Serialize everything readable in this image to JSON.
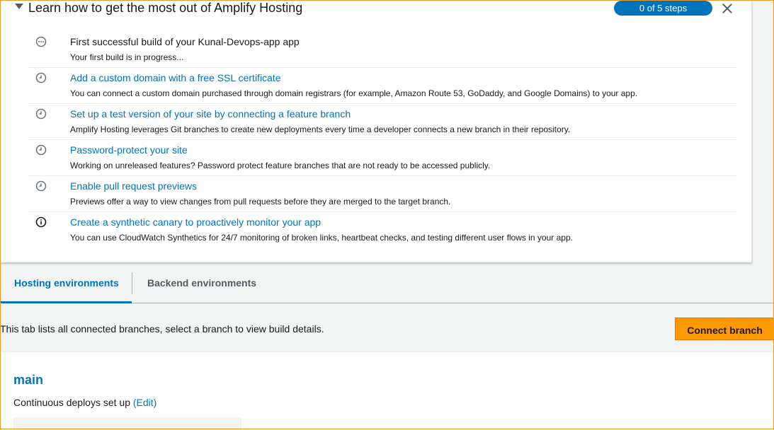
{
  "getting_started": {
    "title": "Learn how to get the most out of Amplify Hosting",
    "progress_badge": "0 of 5 steps complete",
    "steps": [
      {
        "icon": "in-progress-icon",
        "title": "First successful build of your Kunal-Devops-app app",
        "description": "Your first build is in progress..."
      },
      {
        "icon": "pending-clock-icon",
        "title": "Add a custom domain with a free SSL certificate",
        "description": "You can connect a custom domain purchased through domain registrars (for example, Amazon Route 53, GoDaddy, and Google Domains) to your app."
      },
      {
        "icon": "pending-clock-icon",
        "title": "Set up a test version of your site by connecting a feature branch",
        "description": "Amplify Hosting leverages Git branches to create new deployments every time a developer connects a new branch in their repository."
      },
      {
        "icon": "pending-clock-icon",
        "title": "Password-protect your site",
        "description": "Working on unreleased features? Password protect feature branches that are not ready to be accessed publicly."
      },
      {
        "icon": "pending-clock-icon",
        "title": "Enable pull request previews",
        "description": "Previews offer a way to view changes from pull requests before they are merged to the target branch."
      },
      {
        "icon": "info-icon",
        "title": "Create a synthetic canary to proactively monitor your app",
        "description": "You can use CloudWatch Synthetics for 24/7 monitoring of broken links, heartbeat checks, and testing different user flows in your app."
      }
    ]
  },
  "tabs": [
    {
      "label": "Hosting environments",
      "active": true
    },
    {
      "label": "Backend environments",
      "active": false
    }
  ],
  "hosting": {
    "info_text": "This tab lists all connected branches, select a branch to view build details.",
    "connect_button": "Connect branch"
  },
  "branch": {
    "name": "main",
    "status_text": "Continuous deploys set up",
    "edit_link": "(Edit)"
  },
  "colors": {
    "link": "#0073bb",
    "primary_button": "#ff9900",
    "badge": "#0073bb"
  }
}
